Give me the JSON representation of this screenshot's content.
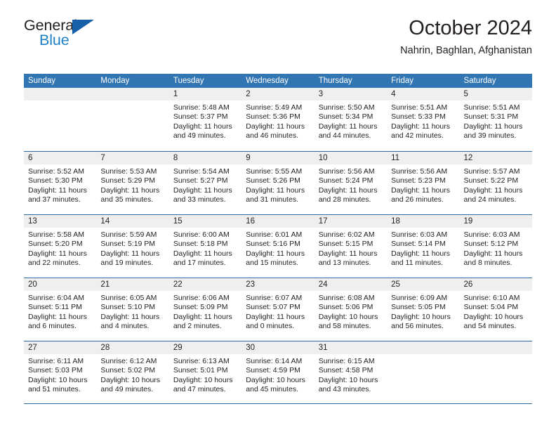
{
  "brand": {
    "name_part1": "General",
    "name_part2": "Blue",
    "logo_icon": "triangle-logo-icon"
  },
  "header": {
    "title": "October 2024",
    "location": "Nahrin, Baghlan, Afghanistan"
  },
  "calendar": {
    "weekday_headers": [
      "Sunday",
      "Monday",
      "Tuesday",
      "Wednesday",
      "Thursday",
      "Friday",
      "Saturday"
    ],
    "colors": {
      "header_blue": "#3275b3",
      "rule_blue": "#2c6aa8",
      "day_band_gray": "#efefef",
      "brand_blue": "#1f7fc4",
      "brand_triangle": "#1560a8",
      "text": "#231f20"
    },
    "weeks": [
      [
        {
          "day": "",
          "lines": []
        },
        {
          "day": "",
          "lines": []
        },
        {
          "day": "1",
          "lines": [
            "Sunrise: 5:48 AM",
            "Sunset: 5:37 PM",
            "Daylight: 11 hours",
            "and 49 minutes."
          ]
        },
        {
          "day": "2",
          "lines": [
            "Sunrise: 5:49 AM",
            "Sunset: 5:36 PM",
            "Daylight: 11 hours",
            "and 46 minutes."
          ]
        },
        {
          "day": "3",
          "lines": [
            "Sunrise: 5:50 AM",
            "Sunset: 5:34 PM",
            "Daylight: 11 hours",
            "and 44 minutes."
          ]
        },
        {
          "day": "4",
          "lines": [
            "Sunrise: 5:51 AM",
            "Sunset: 5:33 PM",
            "Daylight: 11 hours",
            "and 42 minutes."
          ]
        },
        {
          "day": "5",
          "lines": [
            "Sunrise: 5:51 AM",
            "Sunset: 5:31 PM",
            "Daylight: 11 hours",
            "and 39 minutes."
          ]
        }
      ],
      [
        {
          "day": "6",
          "lines": [
            "Sunrise: 5:52 AM",
            "Sunset: 5:30 PM",
            "Daylight: 11 hours",
            "and 37 minutes."
          ]
        },
        {
          "day": "7",
          "lines": [
            "Sunrise: 5:53 AM",
            "Sunset: 5:29 PM",
            "Daylight: 11 hours",
            "and 35 minutes."
          ]
        },
        {
          "day": "8",
          "lines": [
            "Sunrise: 5:54 AM",
            "Sunset: 5:27 PM",
            "Daylight: 11 hours",
            "and 33 minutes."
          ]
        },
        {
          "day": "9",
          "lines": [
            "Sunrise: 5:55 AM",
            "Sunset: 5:26 PM",
            "Daylight: 11 hours",
            "and 31 minutes."
          ]
        },
        {
          "day": "10",
          "lines": [
            "Sunrise: 5:56 AM",
            "Sunset: 5:24 PM",
            "Daylight: 11 hours",
            "and 28 minutes."
          ]
        },
        {
          "day": "11",
          "lines": [
            "Sunrise: 5:56 AM",
            "Sunset: 5:23 PM",
            "Daylight: 11 hours",
            "and 26 minutes."
          ]
        },
        {
          "day": "12",
          "lines": [
            "Sunrise: 5:57 AM",
            "Sunset: 5:22 PM",
            "Daylight: 11 hours",
            "and 24 minutes."
          ]
        }
      ],
      [
        {
          "day": "13",
          "lines": [
            "Sunrise: 5:58 AM",
            "Sunset: 5:20 PM",
            "Daylight: 11 hours",
            "and 22 minutes."
          ]
        },
        {
          "day": "14",
          "lines": [
            "Sunrise: 5:59 AM",
            "Sunset: 5:19 PM",
            "Daylight: 11 hours",
            "and 19 minutes."
          ]
        },
        {
          "day": "15",
          "lines": [
            "Sunrise: 6:00 AM",
            "Sunset: 5:18 PM",
            "Daylight: 11 hours",
            "and 17 minutes."
          ]
        },
        {
          "day": "16",
          "lines": [
            "Sunrise: 6:01 AM",
            "Sunset: 5:16 PM",
            "Daylight: 11 hours",
            "and 15 minutes."
          ]
        },
        {
          "day": "17",
          "lines": [
            "Sunrise: 6:02 AM",
            "Sunset: 5:15 PM",
            "Daylight: 11 hours",
            "and 13 minutes."
          ]
        },
        {
          "day": "18",
          "lines": [
            "Sunrise: 6:03 AM",
            "Sunset: 5:14 PM",
            "Daylight: 11 hours",
            "and 11 minutes."
          ]
        },
        {
          "day": "19",
          "lines": [
            "Sunrise: 6:03 AM",
            "Sunset: 5:12 PM",
            "Daylight: 11 hours",
            "and 8 minutes."
          ]
        }
      ],
      [
        {
          "day": "20",
          "lines": [
            "Sunrise: 6:04 AM",
            "Sunset: 5:11 PM",
            "Daylight: 11 hours",
            "and 6 minutes."
          ]
        },
        {
          "day": "21",
          "lines": [
            "Sunrise: 6:05 AM",
            "Sunset: 5:10 PM",
            "Daylight: 11 hours",
            "and 4 minutes."
          ]
        },
        {
          "day": "22",
          "lines": [
            "Sunrise: 6:06 AM",
            "Sunset: 5:09 PM",
            "Daylight: 11 hours",
            "and 2 minutes."
          ]
        },
        {
          "day": "23",
          "lines": [
            "Sunrise: 6:07 AM",
            "Sunset: 5:07 PM",
            "Daylight: 11 hours",
            "and 0 minutes."
          ]
        },
        {
          "day": "24",
          "lines": [
            "Sunrise: 6:08 AM",
            "Sunset: 5:06 PM",
            "Daylight: 10 hours",
            "and 58 minutes."
          ]
        },
        {
          "day": "25",
          "lines": [
            "Sunrise: 6:09 AM",
            "Sunset: 5:05 PM",
            "Daylight: 10 hours",
            "and 56 minutes."
          ]
        },
        {
          "day": "26",
          "lines": [
            "Sunrise: 6:10 AM",
            "Sunset: 5:04 PM",
            "Daylight: 10 hours",
            "and 54 minutes."
          ]
        }
      ],
      [
        {
          "day": "27",
          "lines": [
            "Sunrise: 6:11 AM",
            "Sunset: 5:03 PM",
            "Daylight: 10 hours",
            "and 51 minutes."
          ]
        },
        {
          "day": "28",
          "lines": [
            "Sunrise: 6:12 AM",
            "Sunset: 5:02 PM",
            "Daylight: 10 hours",
            "and 49 minutes."
          ]
        },
        {
          "day": "29",
          "lines": [
            "Sunrise: 6:13 AM",
            "Sunset: 5:01 PM",
            "Daylight: 10 hours",
            "and 47 minutes."
          ]
        },
        {
          "day": "30",
          "lines": [
            "Sunrise: 6:14 AM",
            "Sunset: 4:59 PM",
            "Daylight: 10 hours",
            "and 45 minutes."
          ]
        },
        {
          "day": "31",
          "lines": [
            "Sunrise: 6:15 AM",
            "Sunset: 4:58 PM",
            "Daylight: 10 hours",
            "and 43 minutes."
          ]
        },
        {
          "day": "",
          "lines": []
        },
        {
          "day": "",
          "lines": []
        }
      ]
    ]
  }
}
